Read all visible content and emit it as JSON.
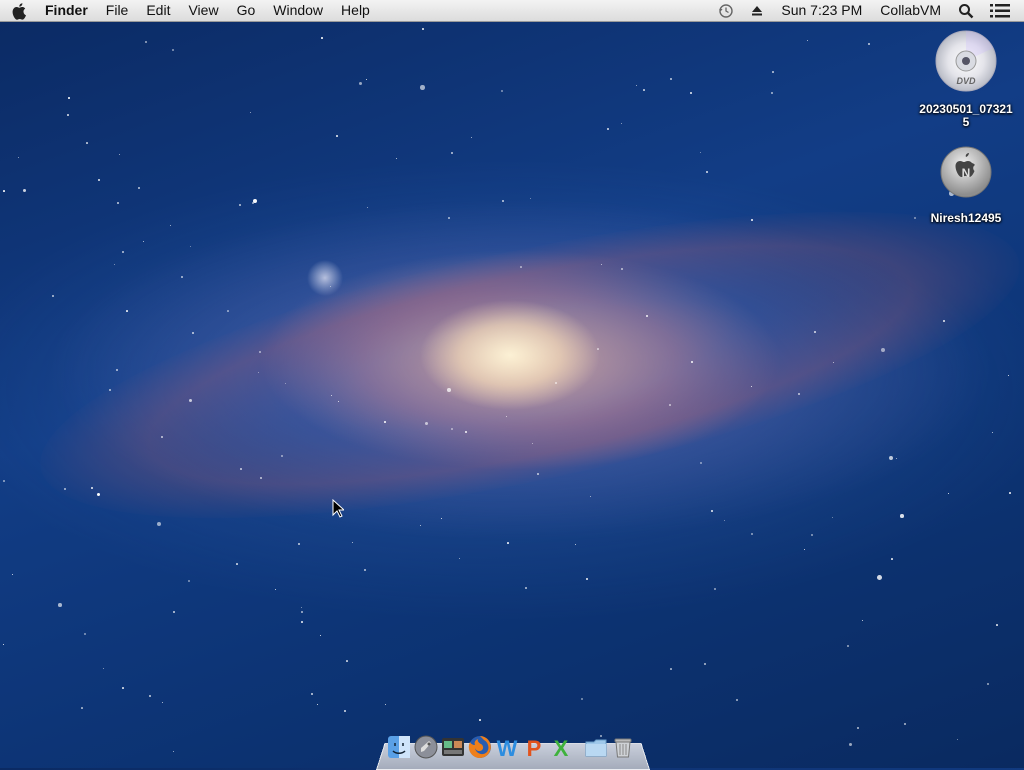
{
  "menubar": {
    "app_name": "Finder",
    "menus": [
      "File",
      "Edit",
      "View",
      "Go",
      "Window",
      "Help"
    ],
    "clock": "Sun 7:23 PM",
    "user": "CollabVM",
    "status_icons": [
      "time-machine-icon",
      "eject-icon",
      "spotlight-search-icon",
      "notification-list-icon"
    ]
  },
  "desktop": {
    "icons": [
      {
        "label": "20230501_073215",
        "icon": "dvd-disc-icon"
      },
      {
        "label": "Niresh12495",
        "icon": "install-disk-icon"
      }
    ]
  },
  "dock": {
    "items": [
      "finder-icon",
      "launchpad-icon",
      "photo-booth-icon",
      "firefox-icon",
      "word-icon",
      "powerpoint-icon",
      "excel-icon",
      "documents-folder-icon",
      "trash-icon"
    ]
  }
}
